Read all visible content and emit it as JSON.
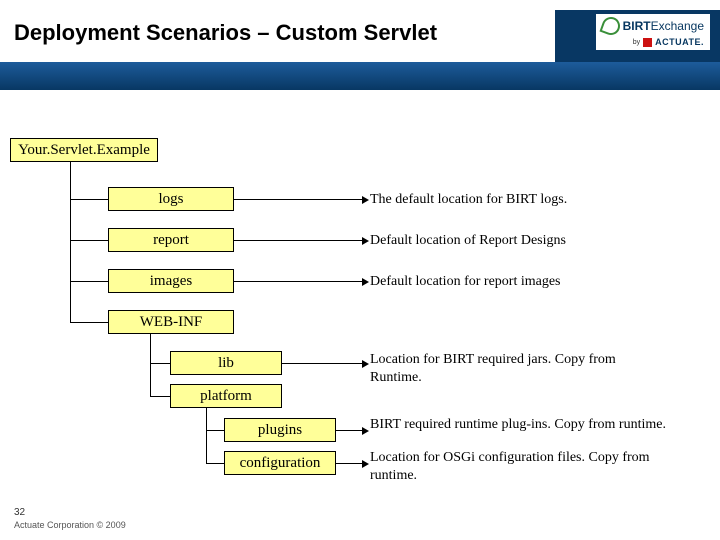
{
  "header": {
    "title": "Deployment Scenarios – Custom Servlet",
    "logo": {
      "brand1": "BIRT",
      "brand2": "Exchange",
      "by": "by",
      "vendor": "ACTUATE."
    }
  },
  "tree": {
    "root": "Your.Servlet.Example",
    "level1": [
      {
        "label": "logs",
        "desc": "The default location for BIRT logs."
      },
      {
        "label": "report",
        "desc": "Default location of Report Designs"
      },
      {
        "label": "images",
        "desc": "Default location for report images"
      },
      {
        "label": "WEB-INF",
        "desc": ""
      }
    ],
    "level2": [
      {
        "label": "lib",
        "desc": "Location for BIRT required jars. Copy from Runtime."
      },
      {
        "label": "platform",
        "desc": ""
      }
    ],
    "level3": [
      {
        "label": "plugins",
        "desc": "BIRT required runtime plug-ins. Copy from runtime."
      },
      {
        "label": "configuration",
        "desc": "Location for OSGi configuration files. Copy from runtime."
      }
    ]
  },
  "footer": {
    "page": "32",
    "copyright": "Actuate Corporation © 2009"
  }
}
